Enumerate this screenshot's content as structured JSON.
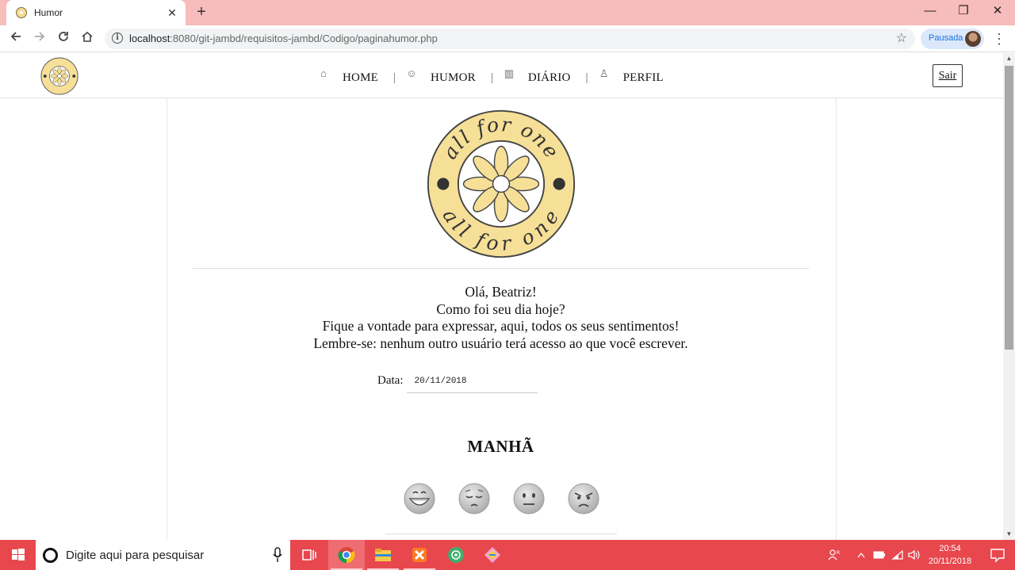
{
  "browser": {
    "tab_title": "Humor",
    "url_host": "localhost",
    "url_rest": ":8080/git-jambd/requisitos-jambd/Codigo/paginahumor.php",
    "profile_label": "Pausada"
  },
  "nav": {
    "items": [
      {
        "label": "HOME",
        "icon": "home-icon"
      },
      {
        "label": "HUMOR",
        "icon": "mood-icon"
      },
      {
        "label": "DIÁRIO",
        "icon": "diary-icon"
      },
      {
        "label": "PERFIL",
        "icon": "user-icon"
      }
    ],
    "separator": "|",
    "logout_label": "Sair"
  },
  "logo": {
    "top_text": "all for one",
    "bottom_text": "all for one",
    "color": "#f6df97"
  },
  "greeting": {
    "line1": "Olá, Beatriz!",
    "line2": "Como foi seu dia hoje?",
    "line3": "Fique a vontade para expressar, aqui, todos os seus sentimentos!",
    "line4": "Lembre-se: nenhum outro usuário terá acesso ao que você escrever."
  },
  "date": {
    "label": "Data:",
    "value": "20/11/2018"
  },
  "period": {
    "title": "MANHÃ",
    "moods": [
      "grinning-face-icon",
      "pensive-face-icon",
      "neutral-face-icon",
      "angry-face-icon"
    ]
  },
  "taskbar": {
    "search_placeholder": "Digite aqui para pesquisar",
    "time": "20:54",
    "date": "20/11/2018",
    "accent": "#e8474e"
  }
}
